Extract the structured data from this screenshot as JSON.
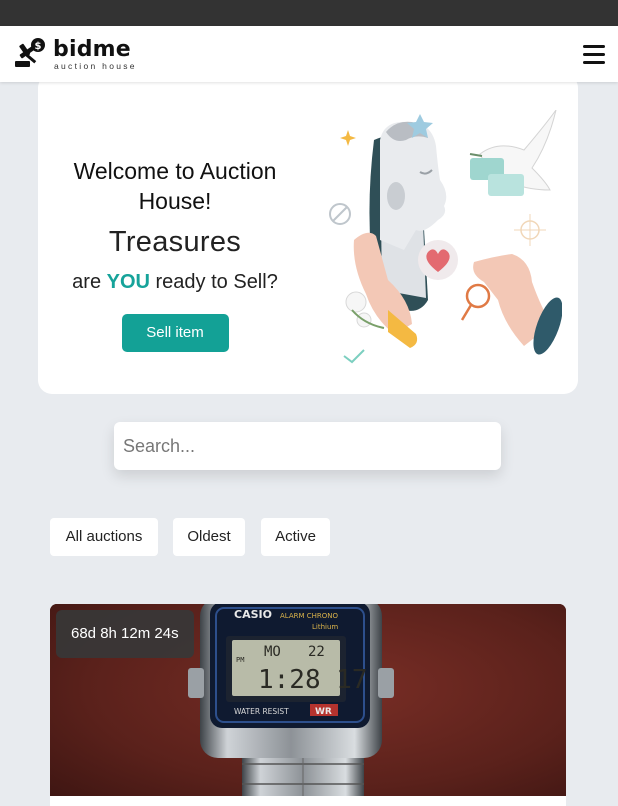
{
  "brand": {
    "name": "bidme",
    "tagline": "auction house"
  },
  "hero": {
    "welcome": "Welcome to Auction House!",
    "title": "Treasures",
    "subtitle_pre": "are ",
    "subtitle_highlight": "YOU",
    "subtitle_post": " ready to Sell?",
    "cta_label": "Sell item"
  },
  "search": {
    "placeholder": "Search..."
  },
  "filters": [
    "All auctions",
    "Oldest",
    "Active"
  ],
  "auction": {
    "countdown": "68d 8h 12m 24s",
    "watch": {
      "brand": "CASIO",
      "model": "ALARM CHRONO",
      "feature": "WATER RESIST",
      "wr": "WR",
      "display_day": "MO",
      "display_date": "22",
      "display_time": "1:28 17",
      "pm": "PM",
      "lithium": "Lithium"
    }
  },
  "colors": {
    "accent": "#13a196",
    "topbar": "#333333",
    "background": "#e8ebef"
  }
}
